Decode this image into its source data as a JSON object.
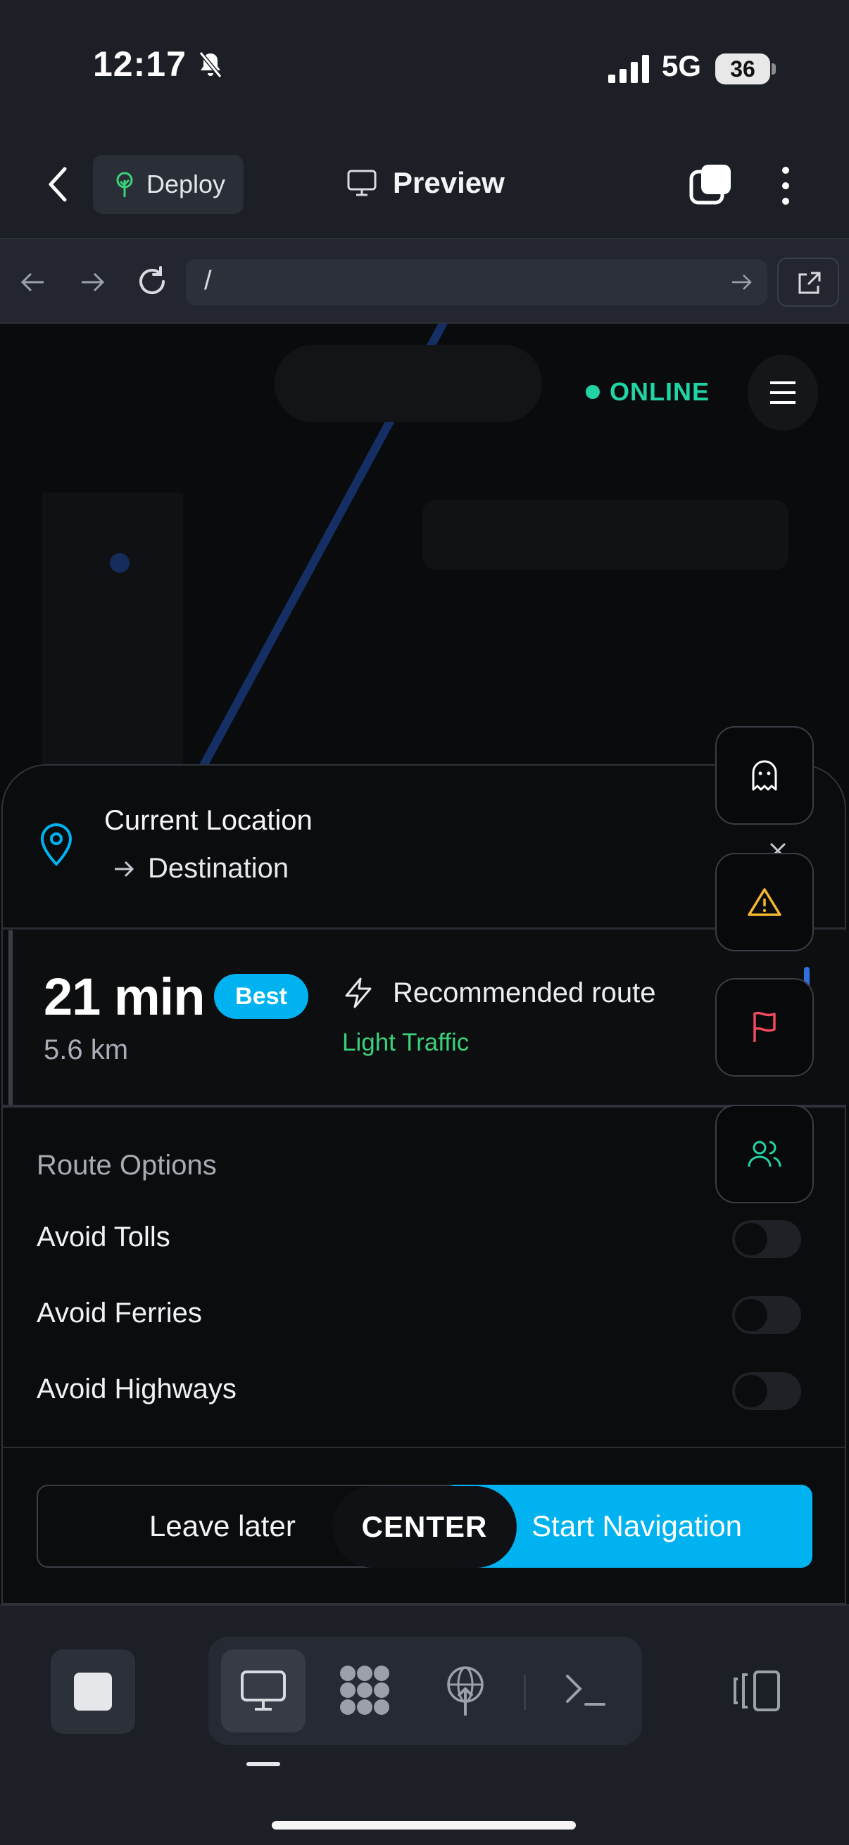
{
  "status_bar": {
    "time": "12:17",
    "network": "5G",
    "battery": "36"
  },
  "app_bar": {
    "deploy_label": "Deploy",
    "preview_label": "Preview"
  },
  "url_bar": {
    "url": "/"
  },
  "map": {
    "online_label": "ONLINE"
  },
  "sheet": {
    "current_location": "Current Location",
    "destination": "Destination",
    "route": {
      "eta": "21 min",
      "badge": "Best",
      "distance": "5.6 km",
      "description": "Recommended route",
      "traffic": "Light Traffic"
    },
    "options": {
      "title": "Route Options",
      "items": [
        {
          "label": "Avoid Tolls",
          "enabled": false
        },
        {
          "label": "Avoid Ferries",
          "enabled": false
        },
        {
          "label": "Avoid Highways",
          "enabled": false
        }
      ]
    },
    "actions": {
      "leave_later": "Leave later",
      "center": "CENTER",
      "start": "Start Navigation"
    }
  },
  "side_buttons": [
    "ghost-icon",
    "warning-icon",
    "flag-icon",
    "users-icon"
  ],
  "colors": {
    "accent": "#00b3f0",
    "online": "#22d3a5",
    "traffic": "#3bd17a",
    "warning": "#f5b731",
    "flag": "#ef4b5f"
  }
}
